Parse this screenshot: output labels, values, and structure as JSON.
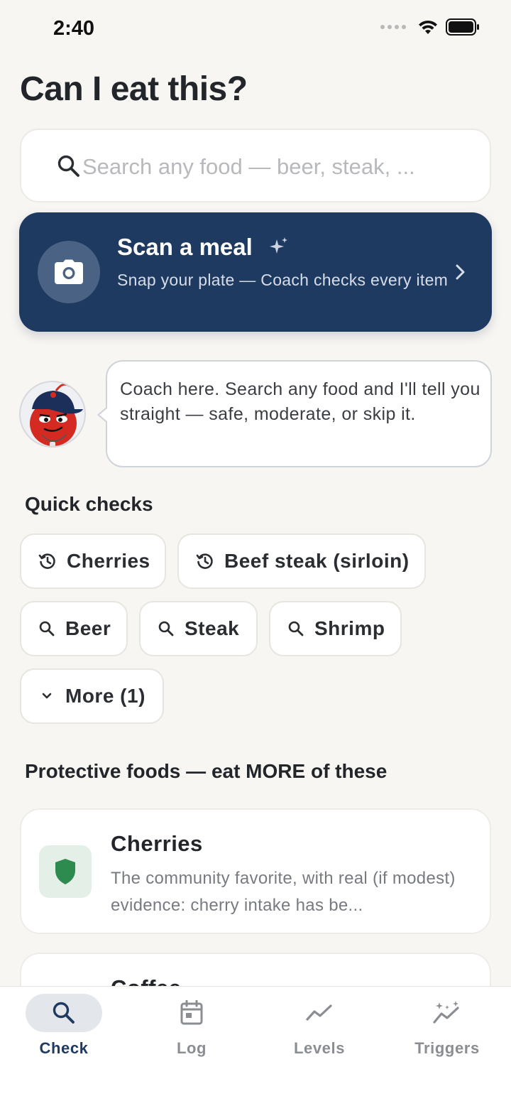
{
  "status_bar": {
    "time": "2:40"
  },
  "page": {
    "title": "Can I eat this?"
  },
  "search": {
    "placeholder": "Search any food — beer, steak, ..."
  },
  "scan_card": {
    "title": "Scan a meal",
    "subtitle": "Snap your plate — Coach checks every item"
  },
  "coach": {
    "message": "Coach here. Search any food and I'll tell you straight — safe, moderate, or skip it."
  },
  "quick_checks": {
    "title": "Quick checks",
    "recent": [
      "Cherries",
      "Beef steak (sirloin)"
    ],
    "suggested": [
      "Beer",
      "Steak",
      "Shrimp"
    ],
    "more_label": "More (1)"
  },
  "protective": {
    "title": "Protective foods — eat MORE of these",
    "items": [
      {
        "name": "Cherries",
        "desc": "The community favorite, with real (if modest) evidence: cherry intake has be..."
      },
      {
        "name": "Coffee",
        "desc": ""
      }
    ]
  },
  "tabs": [
    {
      "label": "Check",
      "icon": "search-icon",
      "active": true
    },
    {
      "label": "Log",
      "icon": "calendar-icon",
      "active": false
    },
    {
      "label": "Levels",
      "icon": "trend-line-icon",
      "active": false
    },
    {
      "label": "Triggers",
      "icon": "sparkle-trend-icon",
      "active": false
    }
  ],
  "colors": {
    "background": "#f8f6f2",
    "accent_navy": "#1f3a61",
    "protective_green": "#2e8b4f"
  }
}
